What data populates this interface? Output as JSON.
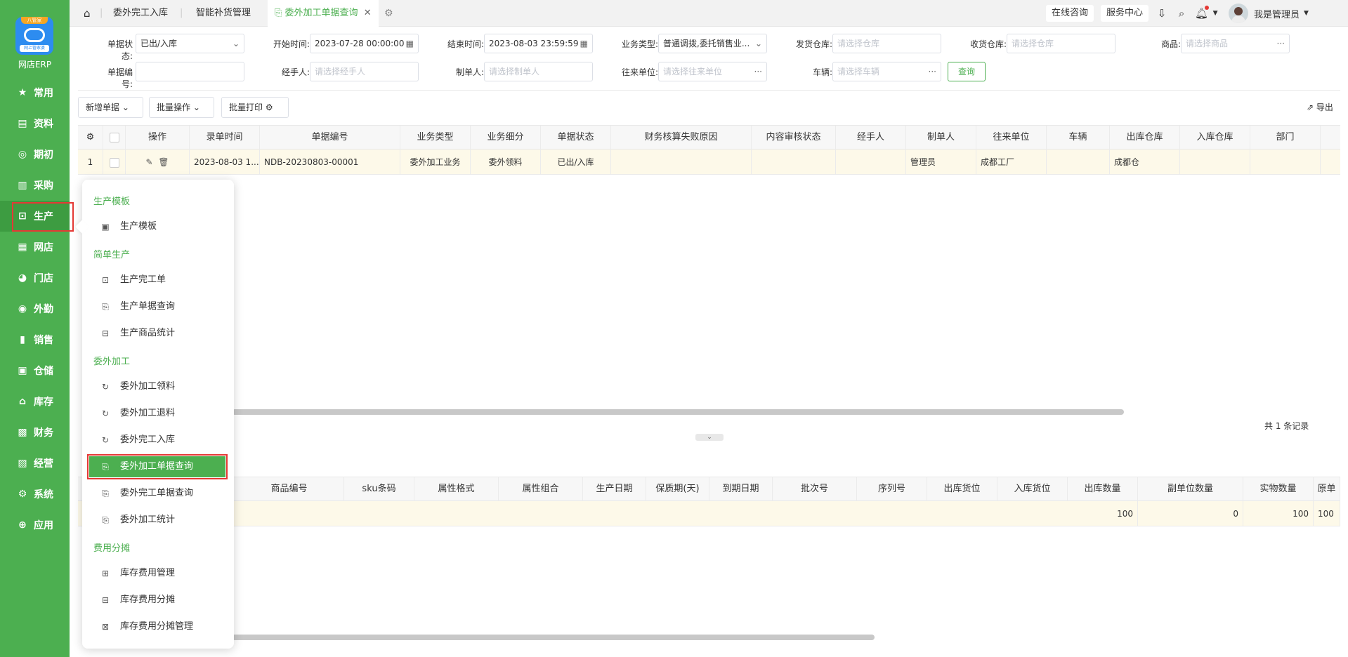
{
  "app": {
    "badge_text": "八管家",
    "logo_sub_text": "网上管家婆",
    "name": "网店ERP"
  },
  "sidebar": {
    "items": [
      {
        "label": "常用",
        "icon": "star-icon"
      },
      {
        "label": "资料",
        "icon": "document-icon"
      },
      {
        "label": "期初",
        "icon": "target-icon"
      },
      {
        "label": "采购",
        "icon": "purchase-icon"
      },
      {
        "label": "生产",
        "icon": "production-icon"
      },
      {
        "label": "网店",
        "icon": "store-icon"
      },
      {
        "label": "门店",
        "icon": "pie-icon"
      },
      {
        "label": "外勤",
        "icon": "field-icon"
      },
      {
        "label": "销售",
        "icon": "sales-icon"
      },
      {
        "label": "仓储",
        "icon": "warehouse-icon"
      },
      {
        "label": "库存",
        "icon": "inventory-icon"
      },
      {
        "label": "财务",
        "icon": "finance-icon"
      },
      {
        "label": "经营",
        "icon": "business-icon"
      },
      {
        "label": "系统",
        "icon": "system-icon"
      },
      {
        "label": "应用",
        "icon": "plus-icon"
      }
    ]
  },
  "tabs": {
    "home_icon": "home-icon",
    "items": [
      "委外完工入库",
      "智能补货管理",
      "委外加工单据查询"
    ]
  },
  "topbar": {
    "online": "在线咨询",
    "service": "服务中心",
    "user": "我是管理员"
  },
  "filters": {
    "status_label": "单据状态:",
    "status_value": "已出/入库",
    "start_label": "开始时间:",
    "start_value": "2023-07-28 00:00:00",
    "end_label": "结束时间:",
    "end_value": "2023-08-03 23:59:59",
    "biztype_label": "业务类型:",
    "biztype_value": "普通调拨,委托销售业...",
    "ship_wh_label": "发货仓库:",
    "ship_wh_placeholder": "请选择仓库",
    "recv_wh_label": "收货仓库:",
    "recv_wh_placeholder": "请选择仓库",
    "goods_label": "商品:",
    "goods_placeholder": "请选择商品",
    "billno_label": "单据编号:",
    "handler_label": "经手人:",
    "handler_placeholder": "请选择经手人",
    "maker_label": "制单人:",
    "maker_placeholder": "请选择制单人",
    "partner_label": "往来单位:",
    "partner_placeholder": "请选择往来单位",
    "vehicle_label": "车辆:",
    "vehicle_placeholder": "请选择车辆",
    "search": "查询"
  },
  "toolbar": {
    "new": "新增单据",
    "batch": "批量操作",
    "print": "批量打印",
    "export": "导出"
  },
  "main_table": {
    "headers": [
      "操作",
      "录单时间",
      "单据编号",
      "业务类型",
      "业务细分",
      "单据状态",
      "财务核算失败原因",
      "内容审核状态",
      "经手人",
      "制单人",
      "往来单位",
      "车辆",
      "出库仓库",
      "入库仓库",
      "部门"
    ],
    "row": {
      "index": "1",
      "time": "2023-08-03 1...",
      "billno": "NDB-20230803-00001",
      "biztype": "委外加工业务",
      "subtype": "委外领料",
      "status": "已出/入库",
      "maker": "管理员",
      "partner": "成都工厂",
      "out_wh": "成都仓"
    },
    "records": "共 1 条记录"
  },
  "detail_table": {
    "headers": [
      "商品编号",
      "sku条码",
      "属性格式",
      "属性组合",
      "生产日期",
      "保质期(天)",
      "到期日期",
      "批次号",
      "序列号",
      "出库货位",
      "入库货位",
      "出库数量",
      "副单位数量",
      "实物数量",
      "原单"
    ],
    "row": {
      "out_qty": "100",
      "sub_qty": "0",
      "real_qty": "100",
      "orig": "100"
    }
  },
  "popup": {
    "groups": [
      {
        "title": "生产模板",
        "items": [
          {
            "label": "生产模板",
            "icon": "template-icon"
          }
        ]
      },
      {
        "title": "简单生产",
        "items": [
          {
            "label": "生产完工单",
            "icon": "doc-check-icon"
          },
          {
            "label": "生产单据查询",
            "icon": "doc-search-icon"
          },
          {
            "label": "生产商品统计",
            "icon": "doc-stat-icon"
          }
        ]
      },
      {
        "title": "委外加工",
        "items": [
          {
            "label": "委外加工领料",
            "icon": "cycle-icon"
          },
          {
            "label": "委外加工退料",
            "icon": "cycle-icon"
          },
          {
            "label": "委外完工入库",
            "icon": "cycle-icon"
          },
          {
            "label": "委外加工单据查询",
            "icon": "doc-search-icon"
          },
          {
            "label": "委外完工单据查询",
            "icon": "doc-search-icon"
          },
          {
            "label": "委外加工统计",
            "icon": "doc-search-icon"
          }
        ]
      },
      {
        "title": "费用分摊",
        "items": [
          {
            "label": "库存费用管理",
            "icon": "cost-icon"
          },
          {
            "label": "库存费用分摊",
            "icon": "split-icon"
          },
          {
            "label": "库存费用分摊管理",
            "icon": "split-manage-icon"
          }
        ]
      }
    ]
  }
}
